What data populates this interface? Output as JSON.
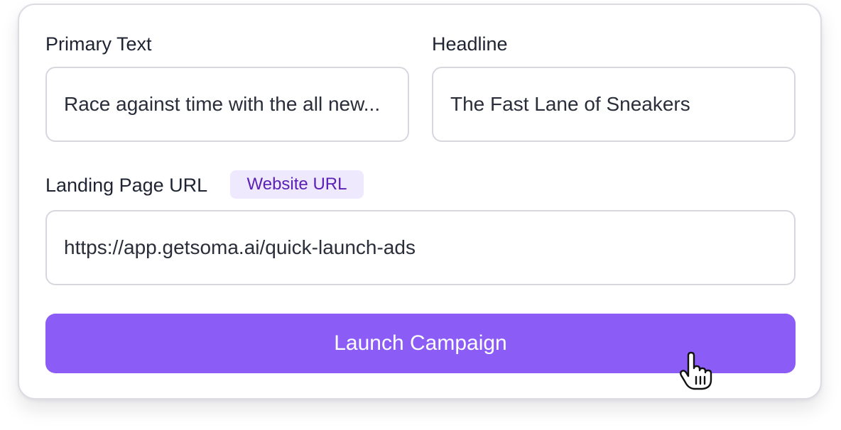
{
  "form": {
    "primary_text": {
      "label": "Primary Text",
      "value": "Race against time with the all new..."
    },
    "headline": {
      "label": "Headline",
      "value": "The Fast Lane of Sneakers"
    },
    "landing_url": {
      "label": "Landing Page URL",
      "badge": "Website URL",
      "value": "https://app.getsoma.ai/quick-launch-ads"
    },
    "submit_label": "Launch Campaign"
  },
  "colors": {
    "accent": "#8b5cf6",
    "badge_bg": "#efe9fd",
    "badge_text": "#5b21b6",
    "border": "#d6d8de",
    "label_text": "#1f2433"
  },
  "icons": {
    "cursor": "hand-pointer-icon"
  }
}
